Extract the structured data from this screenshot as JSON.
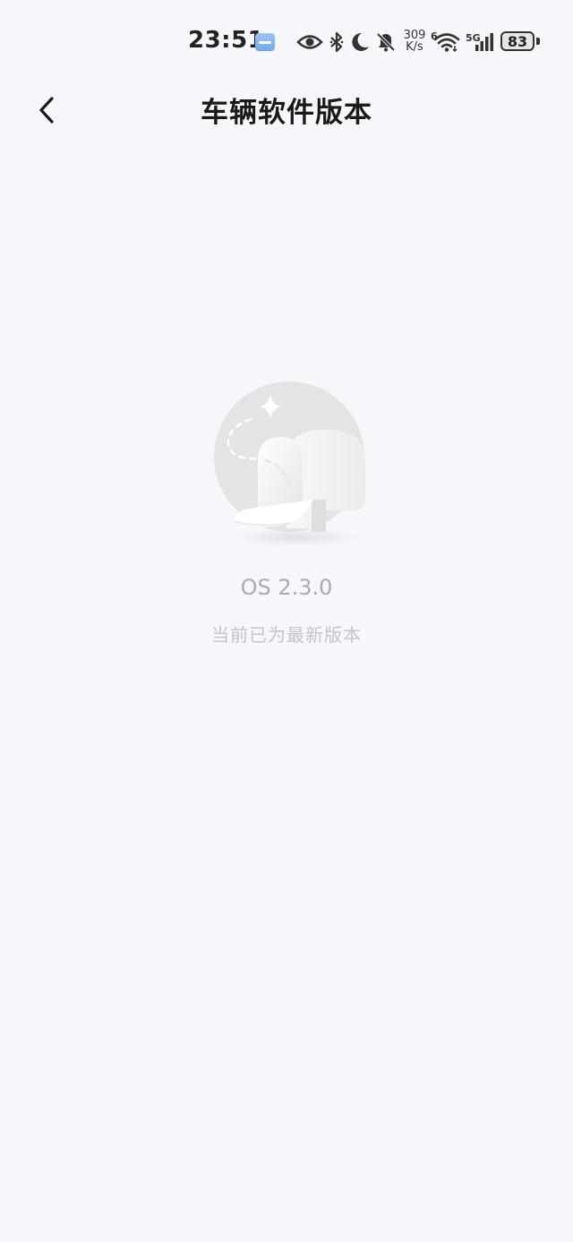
{
  "status_bar": {
    "time": "23:51",
    "net_speed_value": "309",
    "net_speed_unit": "K/s",
    "wifi_label": "6",
    "signal_label": "5G",
    "battery_level": "83",
    "icons": [
      "app-notification-icon",
      "eye-icon",
      "bluetooth-icon",
      "moon-icon",
      "bell-off-icon",
      "wifi-icon",
      "signal-icon",
      "battery-icon"
    ]
  },
  "header": {
    "back_icon": "chevron-left-icon",
    "title": "车辆软件版本"
  },
  "main": {
    "illustration": "mailbox-illustration",
    "version": "OS 2.3.0",
    "status": "当前已为最新版本"
  },
  "colors": {
    "background": "#f5f7fb",
    "title": "#1a1a1a",
    "version_text": "#a8abb1",
    "status_text": "#c3c5ca"
  }
}
